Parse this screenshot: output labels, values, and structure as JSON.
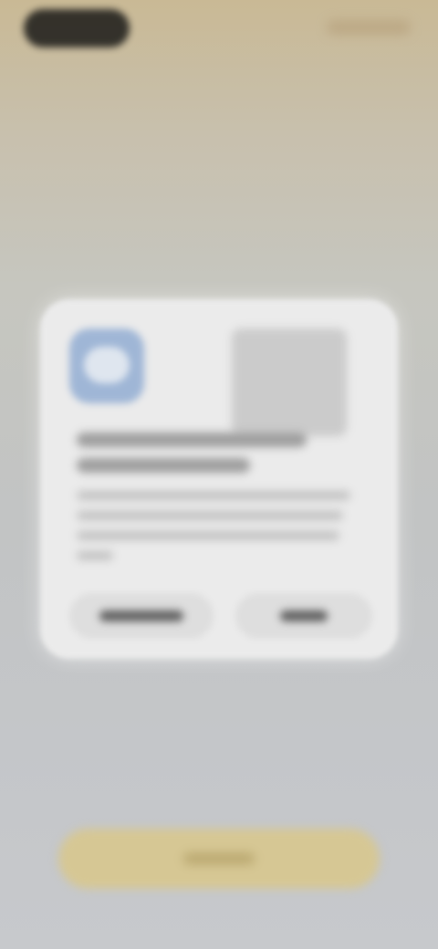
{
  "screen": {
    "blurred": true,
    "background_top_color": "#c9b995",
    "background_bottom_color": "#c7c9cc"
  },
  "status_bar": {
    "left_pill_color": "#24231f"
  },
  "dialog": {
    "background_color": "#ebebeb",
    "app_icon": "app-icon",
    "image": "image-placeholder",
    "title_text": "",
    "body_text": "",
    "buttons": [
      {
        "label": ""
      },
      {
        "label": ""
      }
    ]
  },
  "bottom_action": {
    "label": "",
    "color": "#d6c794"
  }
}
